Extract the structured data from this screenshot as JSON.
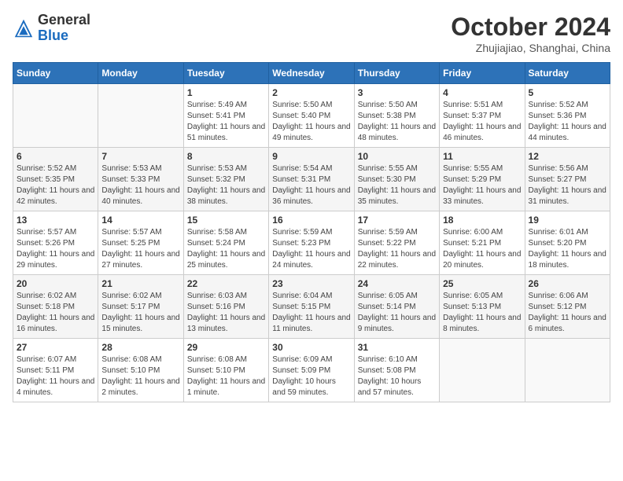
{
  "header": {
    "logo_general": "General",
    "logo_blue": "Blue",
    "title": "October 2024",
    "location": "Zhujiajiao, Shanghai, China"
  },
  "weekdays": [
    "Sunday",
    "Monday",
    "Tuesday",
    "Wednesday",
    "Thursday",
    "Friday",
    "Saturday"
  ],
  "weeks": [
    [
      {
        "day": "",
        "info": ""
      },
      {
        "day": "",
        "info": ""
      },
      {
        "day": "1",
        "info": "Sunrise: 5:49 AM\nSunset: 5:41 PM\nDaylight: 11 hours and 51 minutes."
      },
      {
        "day": "2",
        "info": "Sunrise: 5:50 AM\nSunset: 5:40 PM\nDaylight: 11 hours and 49 minutes."
      },
      {
        "day": "3",
        "info": "Sunrise: 5:50 AM\nSunset: 5:38 PM\nDaylight: 11 hours and 48 minutes."
      },
      {
        "day": "4",
        "info": "Sunrise: 5:51 AM\nSunset: 5:37 PM\nDaylight: 11 hours and 46 minutes."
      },
      {
        "day": "5",
        "info": "Sunrise: 5:52 AM\nSunset: 5:36 PM\nDaylight: 11 hours and 44 minutes."
      }
    ],
    [
      {
        "day": "6",
        "info": "Sunrise: 5:52 AM\nSunset: 5:35 PM\nDaylight: 11 hours and 42 minutes."
      },
      {
        "day": "7",
        "info": "Sunrise: 5:53 AM\nSunset: 5:33 PM\nDaylight: 11 hours and 40 minutes."
      },
      {
        "day": "8",
        "info": "Sunrise: 5:53 AM\nSunset: 5:32 PM\nDaylight: 11 hours and 38 minutes."
      },
      {
        "day": "9",
        "info": "Sunrise: 5:54 AM\nSunset: 5:31 PM\nDaylight: 11 hours and 36 minutes."
      },
      {
        "day": "10",
        "info": "Sunrise: 5:55 AM\nSunset: 5:30 PM\nDaylight: 11 hours and 35 minutes."
      },
      {
        "day": "11",
        "info": "Sunrise: 5:55 AM\nSunset: 5:29 PM\nDaylight: 11 hours and 33 minutes."
      },
      {
        "day": "12",
        "info": "Sunrise: 5:56 AM\nSunset: 5:27 PM\nDaylight: 11 hours and 31 minutes."
      }
    ],
    [
      {
        "day": "13",
        "info": "Sunrise: 5:57 AM\nSunset: 5:26 PM\nDaylight: 11 hours and 29 minutes."
      },
      {
        "day": "14",
        "info": "Sunrise: 5:57 AM\nSunset: 5:25 PM\nDaylight: 11 hours and 27 minutes."
      },
      {
        "day": "15",
        "info": "Sunrise: 5:58 AM\nSunset: 5:24 PM\nDaylight: 11 hours and 25 minutes."
      },
      {
        "day": "16",
        "info": "Sunrise: 5:59 AM\nSunset: 5:23 PM\nDaylight: 11 hours and 24 minutes."
      },
      {
        "day": "17",
        "info": "Sunrise: 5:59 AM\nSunset: 5:22 PM\nDaylight: 11 hours and 22 minutes."
      },
      {
        "day": "18",
        "info": "Sunrise: 6:00 AM\nSunset: 5:21 PM\nDaylight: 11 hours and 20 minutes."
      },
      {
        "day": "19",
        "info": "Sunrise: 6:01 AM\nSunset: 5:20 PM\nDaylight: 11 hours and 18 minutes."
      }
    ],
    [
      {
        "day": "20",
        "info": "Sunrise: 6:02 AM\nSunset: 5:18 PM\nDaylight: 11 hours and 16 minutes."
      },
      {
        "day": "21",
        "info": "Sunrise: 6:02 AM\nSunset: 5:17 PM\nDaylight: 11 hours and 15 minutes."
      },
      {
        "day": "22",
        "info": "Sunrise: 6:03 AM\nSunset: 5:16 PM\nDaylight: 11 hours and 13 minutes."
      },
      {
        "day": "23",
        "info": "Sunrise: 6:04 AM\nSunset: 5:15 PM\nDaylight: 11 hours and 11 minutes."
      },
      {
        "day": "24",
        "info": "Sunrise: 6:05 AM\nSunset: 5:14 PM\nDaylight: 11 hours and 9 minutes."
      },
      {
        "day": "25",
        "info": "Sunrise: 6:05 AM\nSunset: 5:13 PM\nDaylight: 11 hours and 8 minutes."
      },
      {
        "day": "26",
        "info": "Sunrise: 6:06 AM\nSunset: 5:12 PM\nDaylight: 11 hours and 6 minutes."
      }
    ],
    [
      {
        "day": "27",
        "info": "Sunrise: 6:07 AM\nSunset: 5:11 PM\nDaylight: 11 hours and 4 minutes."
      },
      {
        "day": "28",
        "info": "Sunrise: 6:08 AM\nSunset: 5:10 PM\nDaylight: 11 hours and 2 minutes."
      },
      {
        "day": "29",
        "info": "Sunrise: 6:08 AM\nSunset: 5:10 PM\nDaylight: 11 hours and 1 minute."
      },
      {
        "day": "30",
        "info": "Sunrise: 6:09 AM\nSunset: 5:09 PM\nDaylight: 10 hours and 59 minutes."
      },
      {
        "day": "31",
        "info": "Sunrise: 6:10 AM\nSunset: 5:08 PM\nDaylight: 10 hours and 57 minutes."
      },
      {
        "day": "",
        "info": ""
      },
      {
        "day": "",
        "info": ""
      }
    ]
  ]
}
